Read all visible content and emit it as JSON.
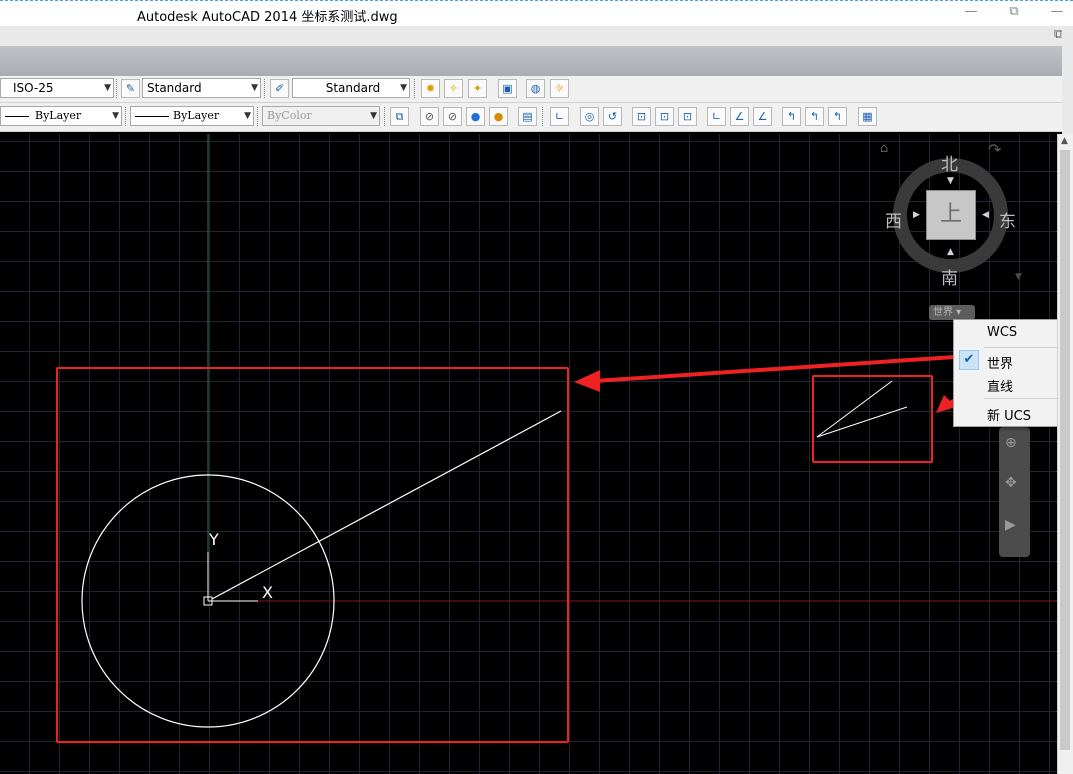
{
  "window": {
    "title": "Autodesk AutoCAD 2014    坐标系测试.dwg",
    "minimize_glyph": "—",
    "restore_glyph": "⧉",
    "close_glyph": "—"
  },
  "toolbar_styles": {
    "dim_style": "ISO-25",
    "text_style": "Standard",
    "table_style": "Standard"
  },
  "toolbar_properties": {
    "linetype": "ByLayer",
    "lineweight": "ByLayer",
    "color": "ByColor"
  },
  "viewcube": {
    "north": "北",
    "south": "南",
    "east": "东",
    "west": "西",
    "face": "上",
    "wcs_menu_button": "世界 ▾"
  },
  "ucs_menu": {
    "items": [
      {
        "label": "WCS",
        "checked": false
      },
      {
        "label": "世界",
        "checked": true
      },
      {
        "label": "直线",
        "checked": false
      },
      {
        "label": "新 UCS",
        "checked": false
      }
    ]
  },
  "ucs_icon": {
    "y_label": "Y",
    "x_label": "X"
  },
  "colors": {
    "annotation_red": "#ee2222",
    "canvas_bg": "#000000",
    "grid": "#1f2533",
    "y_axis": "#2e7d32",
    "x_axis": "#7a1a1a"
  }
}
